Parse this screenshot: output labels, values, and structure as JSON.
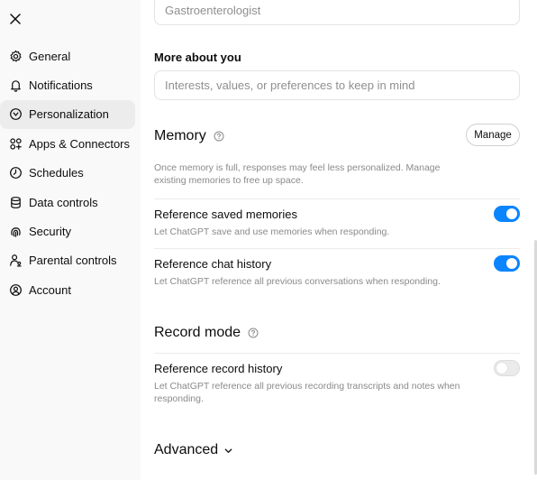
{
  "sidebar": {
    "close_icon": "close-icon",
    "items": [
      {
        "label": "General",
        "icon": "gear-icon"
      },
      {
        "label": "Notifications",
        "icon": "bell-icon"
      },
      {
        "label": "Personalization",
        "icon": "personalization-icon",
        "active": true
      },
      {
        "label": "Apps & Connectors",
        "icon": "apps-icon"
      },
      {
        "label": "Schedules",
        "icon": "clock-icon"
      },
      {
        "label": "Data controls",
        "icon": "database-icon"
      },
      {
        "label": "Security",
        "icon": "fingerprint-icon"
      },
      {
        "label": "Parental controls",
        "icon": "parental-icon"
      },
      {
        "label": "Account",
        "icon": "account-icon"
      }
    ]
  },
  "main": {
    "occupation_value": "Gastroenterologist",
    "more_about": {
      "label": "More about you",
      "placeholder": "Interests, values, or preferences to keep in mind"
    },
    "memory": {
      "title": "Memory",
      "manage_label": "Manage",
      "description": "Once memory is full, responses may feel less personalized. Manage existing memories to free up space.",
      "saved_memories": {
        "title": "Reference saved memories",
        "description": "Let ChatGPT save and use memories when responding.",
        "enabled": true
      },
      "chat_history": {
        "title": "Reference chat history",
        "description": "Let ChatGPT reference all previous conversations when responding.",
        "enabled": true
      }
    },
    "record_mode": {
      "title": "Record mode",
      "record_history": {
        "title": "Reference record history",
        "description": "Let ChatGPT reference all previous recording transcripts and notes when responding.",
        "enabled": false
      }
    },
    "advanced_label": "Advanced"
  },
  "colors": {
    "toggle_on": "#0a84ff",
    "sidebar_bg": "#f9f9f9",
    "active_item_bg": "#ececec"
  }
}
